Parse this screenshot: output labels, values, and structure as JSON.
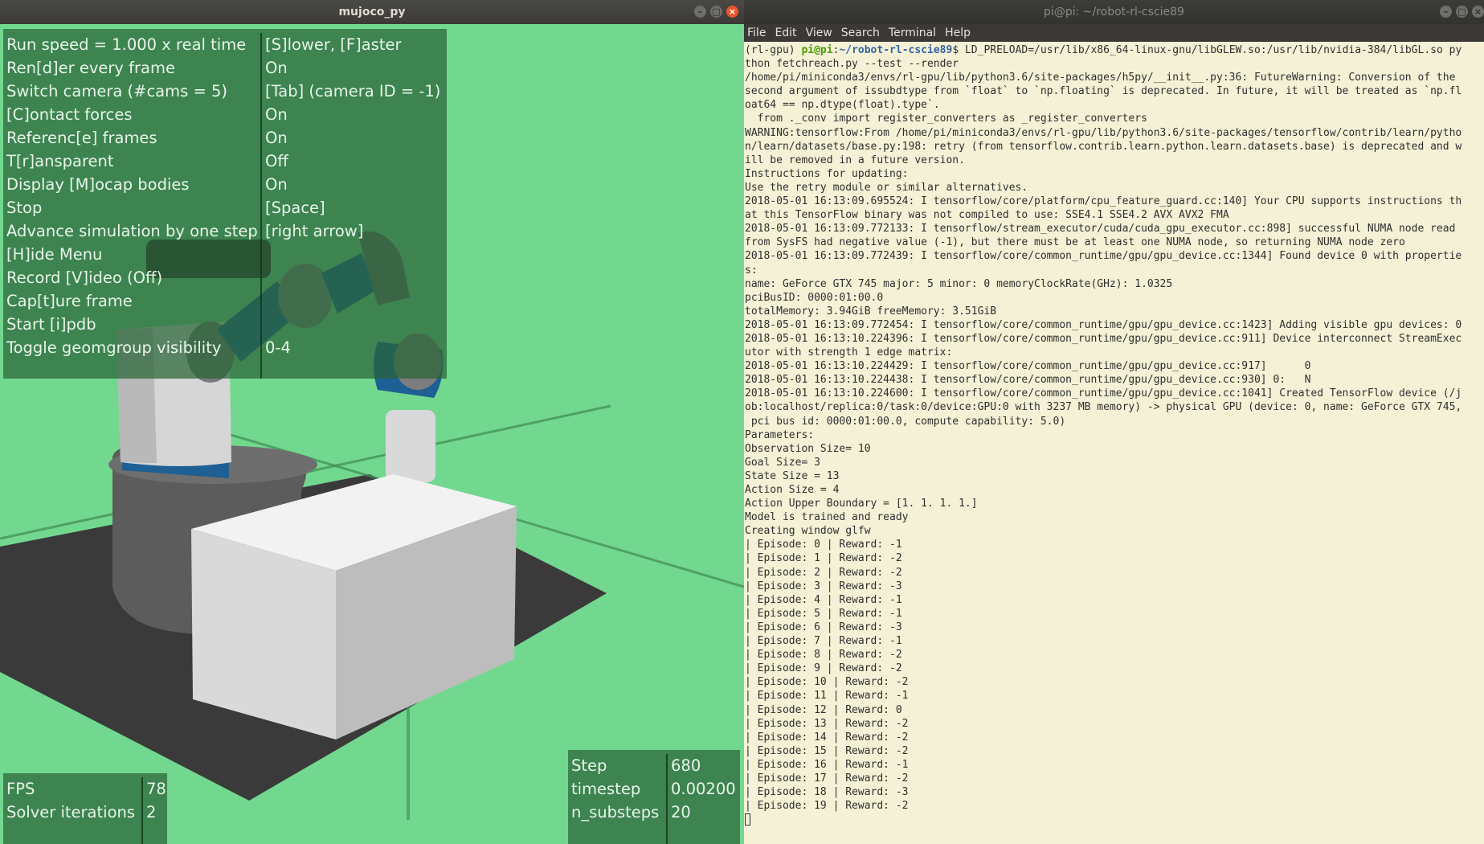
{
  "left_window": {
    "title": "mujoco_py",
    "menu": [
      {
        "key": "Run speed = 1.000 x real time",
        "value": "[S]lower, [F]aster"
      },
      {
        "key": "Ren[d]er every frame",
        "value": "On"
      },
      {
        "key": "Switch camera (#cams = 5)",
        "value": "[Tab] (camera ID = -1)"
      },
      {
        "key": "[C]ontact forces",
        "value": "On"
      },
      {
        "key": "Referenc[e] frames",
        "value": "On"
      },
      {
        "key": "T[r]ansparent",
        "value": "Off"
      },
      {
        "key": "Display [M]ocap bodies",
        "value": "On"
      },
      {
        "key": "Stop",
        "value": "[Space]"
      },
      {
        "key": "Advance simulation by one step",
        "value": "[right arrow]"
      },
      {
        "key": "[H]ide Menu",
        "value": ""
      },
      {
        "key": "Record [V]ideo (Off)",
        "value": ""
      },
      {
        "key": "Cap[t]ure frame",
        "value": ""
      },
      {
        "key": "Start [i]pdb",
        "value": ""
      },
      {
        "key": "Toggle geomgroup visibility",
        "value": "0-4"
      }
    ],
    "stats": [
      {
        "key": "FPS",
        "value": "78"
      },
      {
        "key": "Solver iterations",
        "value": "2"
      }
    ],
    "sim": [
      {
        "key": "Step",
        "value": "680"
      },
      {
        "key": "timestep",
        "value": "0.00200"
      },
      {
        "key": "n_substeps",
        "value": "20"
      }
    ],
    "colors": {
      "background": "#72d88f",
      "floor": "#3a3a3a",
      "table": "#f2f2f2",
      "arm_blue": "#1e5f94",
      "target": "#e41010"
    }
  },
  "right_window": {
    "title": "pi@pi: ~/robot-rl-cscie89",
    "menu": [
      "File",
      "Edit",
      "View",
      "Search",
      "Terminal",
      "Help"
    ],
    "prompt": {
      "env": "(rl-gpu) ",
      "user_host": "pi@pi",
      "colon": ":",
      "path": "~/robot-rl-cscie89",
      "dollar": "$ ",
      "command": "LD_PRELOAD=/usr/lib/x86_64-linux-gnu/libGLEW.so:/usr/lib/nvidia-384/libGL.so py"
    },
    "lines": [
      "thon fetchreach.py --test --render",
      "/home/pi/miniconda3/envs/rl-gpu/lib/python3.6/site-packages/h5py/__init__.py:36: FutureWarning: Conversion of the",
      "second argument of issubdtype from `float` to `np.floating` is deprecated. In future, it will be treated as `np.fl",
      "oat64 == np.dtype(float).type`.",
      "  from ._conv import register_converters as _register_converters",
      "WARNING:tensorflow:From /home/pi/miniconda3/envs/rl-gpu/lib/python3.6/site-packages/tensorflow/contrib/learn/pytho",
      "n/learn/datasets/base.py:198: retry (from tensorflow.contrib.learn.python.learn.datasets.base) is deprecated and w",
      "ill be removed in a future version.",
      "Instructions for updating:",
      "Use the retry module or similar alternatives.",
      "2018-05-01 16:13:09.695524: I tensorflow/core/platform/cpu_feature_guard.cc:140] Your CPU supports instructions th",
      "at this TensorFlow binary was not compiled to use: SSE4.1 SSE4.2 AVX AVX2 FMA",
      "2018-05-01 16:13:09.772133: I tensorflow/stream_executor/cuda/cuda_gpu_executor.cc:898] successful NUMA node read",
      "from SysFS had negative value (-1), but there must be at least one NUMA node, so returning NUMA node zero",
      "2018-05-01 16:13:09.772439: I tensorflow/core/common_runtime/gpu/gpu_device.cc:1344] Found device 0 with propertie",
      "s:",
      "name: GeForce GTX 745 major: 5 minor: 0 memoryClockRate(GHz): 1.0325",
      "pciBusID: 0000:01:00.0",
      "totalMemory: 3.94GiB freeMemory: 3.51GiB",
      "2018-05-01 16:13:09.772454: I tensorflow/core/common_runtime/gpu/gpu_device.cc:1423] Adding visible gpu devices: 0",
      "2018-05-01 16:13:10.224396: I tensorflow/core/common_runtime/gpu/gpu_device.cc:911] Device interconnect StreamExec",
      "utor with strength 1 edge matrix:",
      "2018-05-01 16:13:10.224429: I tensorflow/core/common_runtime/gpu/gpu_device.cc:917]      0",
      "2018-05-01 16:13:10.224438: I tensorflow/core/common_runtime/gpu/gpu_device.cc:930] 0:   N",
      "2018-05-01 16:13:10.224600: I tensorflow/core/common_runtime/gpu/gpu_device.cc:1041] Created TensorFlow device (/j",
      "ob:localhost/replica:0/task:0/device:GPU:0 with 3237 MB memory) -> physical GPU (device: 0, name: GeForce GTX 745,",
      " pci bus id: 0000:01:00.0, compute capability: 5.0)",
      "Parameters:",
      "Observation Size= 10",
      "Goal Size= 3",
      "State Size = 13",
      "Action Size = 4",
      "Action Upper Boundary = [1. 1. 1. 1.]",
      "Model is trained and ready",
      "Creating window glfw",
      "| Episode: 0 | Reward: -1",
      "| Episode: 1 | Reward: -2",
      "| Episode: 2 | Reward: -2",
      "| Episode: 3 | Reward: -3",
      "| Episode: 4 | Reward: -1",
      "| Episode: 5 | Reward: -1",
      "| Episode: 6 | Reward: -3",
      "| Episode: 7 | Reward: -1",
      "| Episode: 8 | Reward: -2",
      "| Episode: 9 | Reward: -2",
      "| Episode: 10 | Reward: -2",
      "| Episode: 11 | Reward: -1",
      "| Episode: 12 | Reward: 0",
      "| Episode: 13 | Reward: -2",
      "| Episode: 14 | Reward: -2",
      "| Episode: 15 | Reward: -2",
      "| Episode: 16 | Reward: -1",
      "| Episode: 17 | Reward: -2",
      "| Episode: 18 | Reward: -3",
      "| Episode: 19 | Reward: -2"
    ],
    "colors": {
      "background": "#f4f1d6",
      "prompt_user": "#4a9a06",
      "prompt_path": "#3465a4"
    }
  }
}
